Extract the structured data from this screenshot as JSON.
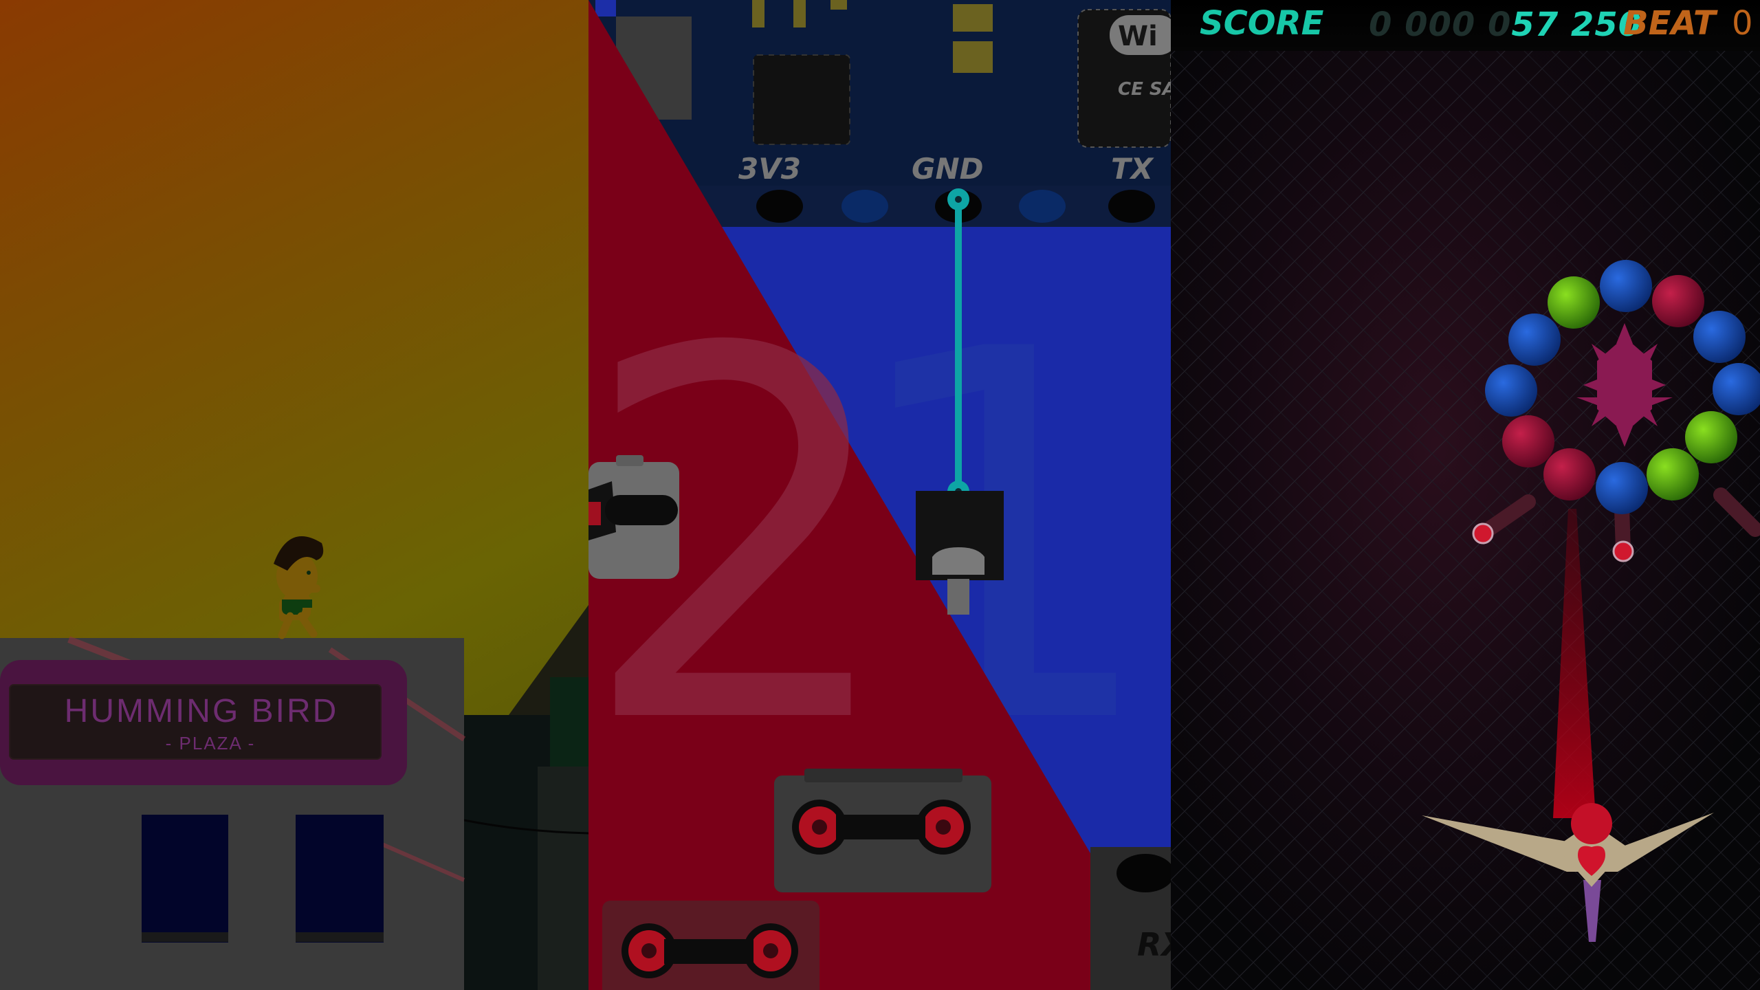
{
  "panels": {
    "platformer": {
      "sign_title": "HUMMING BIRD",
      "sign_subtitle": "- PLAZA -"
    },
    "circuit": {
      "pin_labels": [
        "3V3",
        "GND",
        "TX"
      ],
      "bottom_right_label": "RX",
      "big_numbers": [
        "2",
        "1"
      ],
      "chip_badge": "Wi",
      "chip_caption": "CE SA",
      "wire_color": "#0ea5a5",
      "board_color": "#0a1a3a",
      "blue_area_color": "#1a2aa8",
      "red_area_color": "#7a0018"
    },
    "shooter": {
      "hud": {
        "score_label": "SCORE",
        "score_dim_digits": "0 000 0",
        "score_lit_digits": "57 250",
        "beat_label": "BEAT",
        "beat_value": "0"
      },
      "colors": {
        "score": "#1fd3b5",
        "beat": "#c0641a"
      }
    }
  }
}
